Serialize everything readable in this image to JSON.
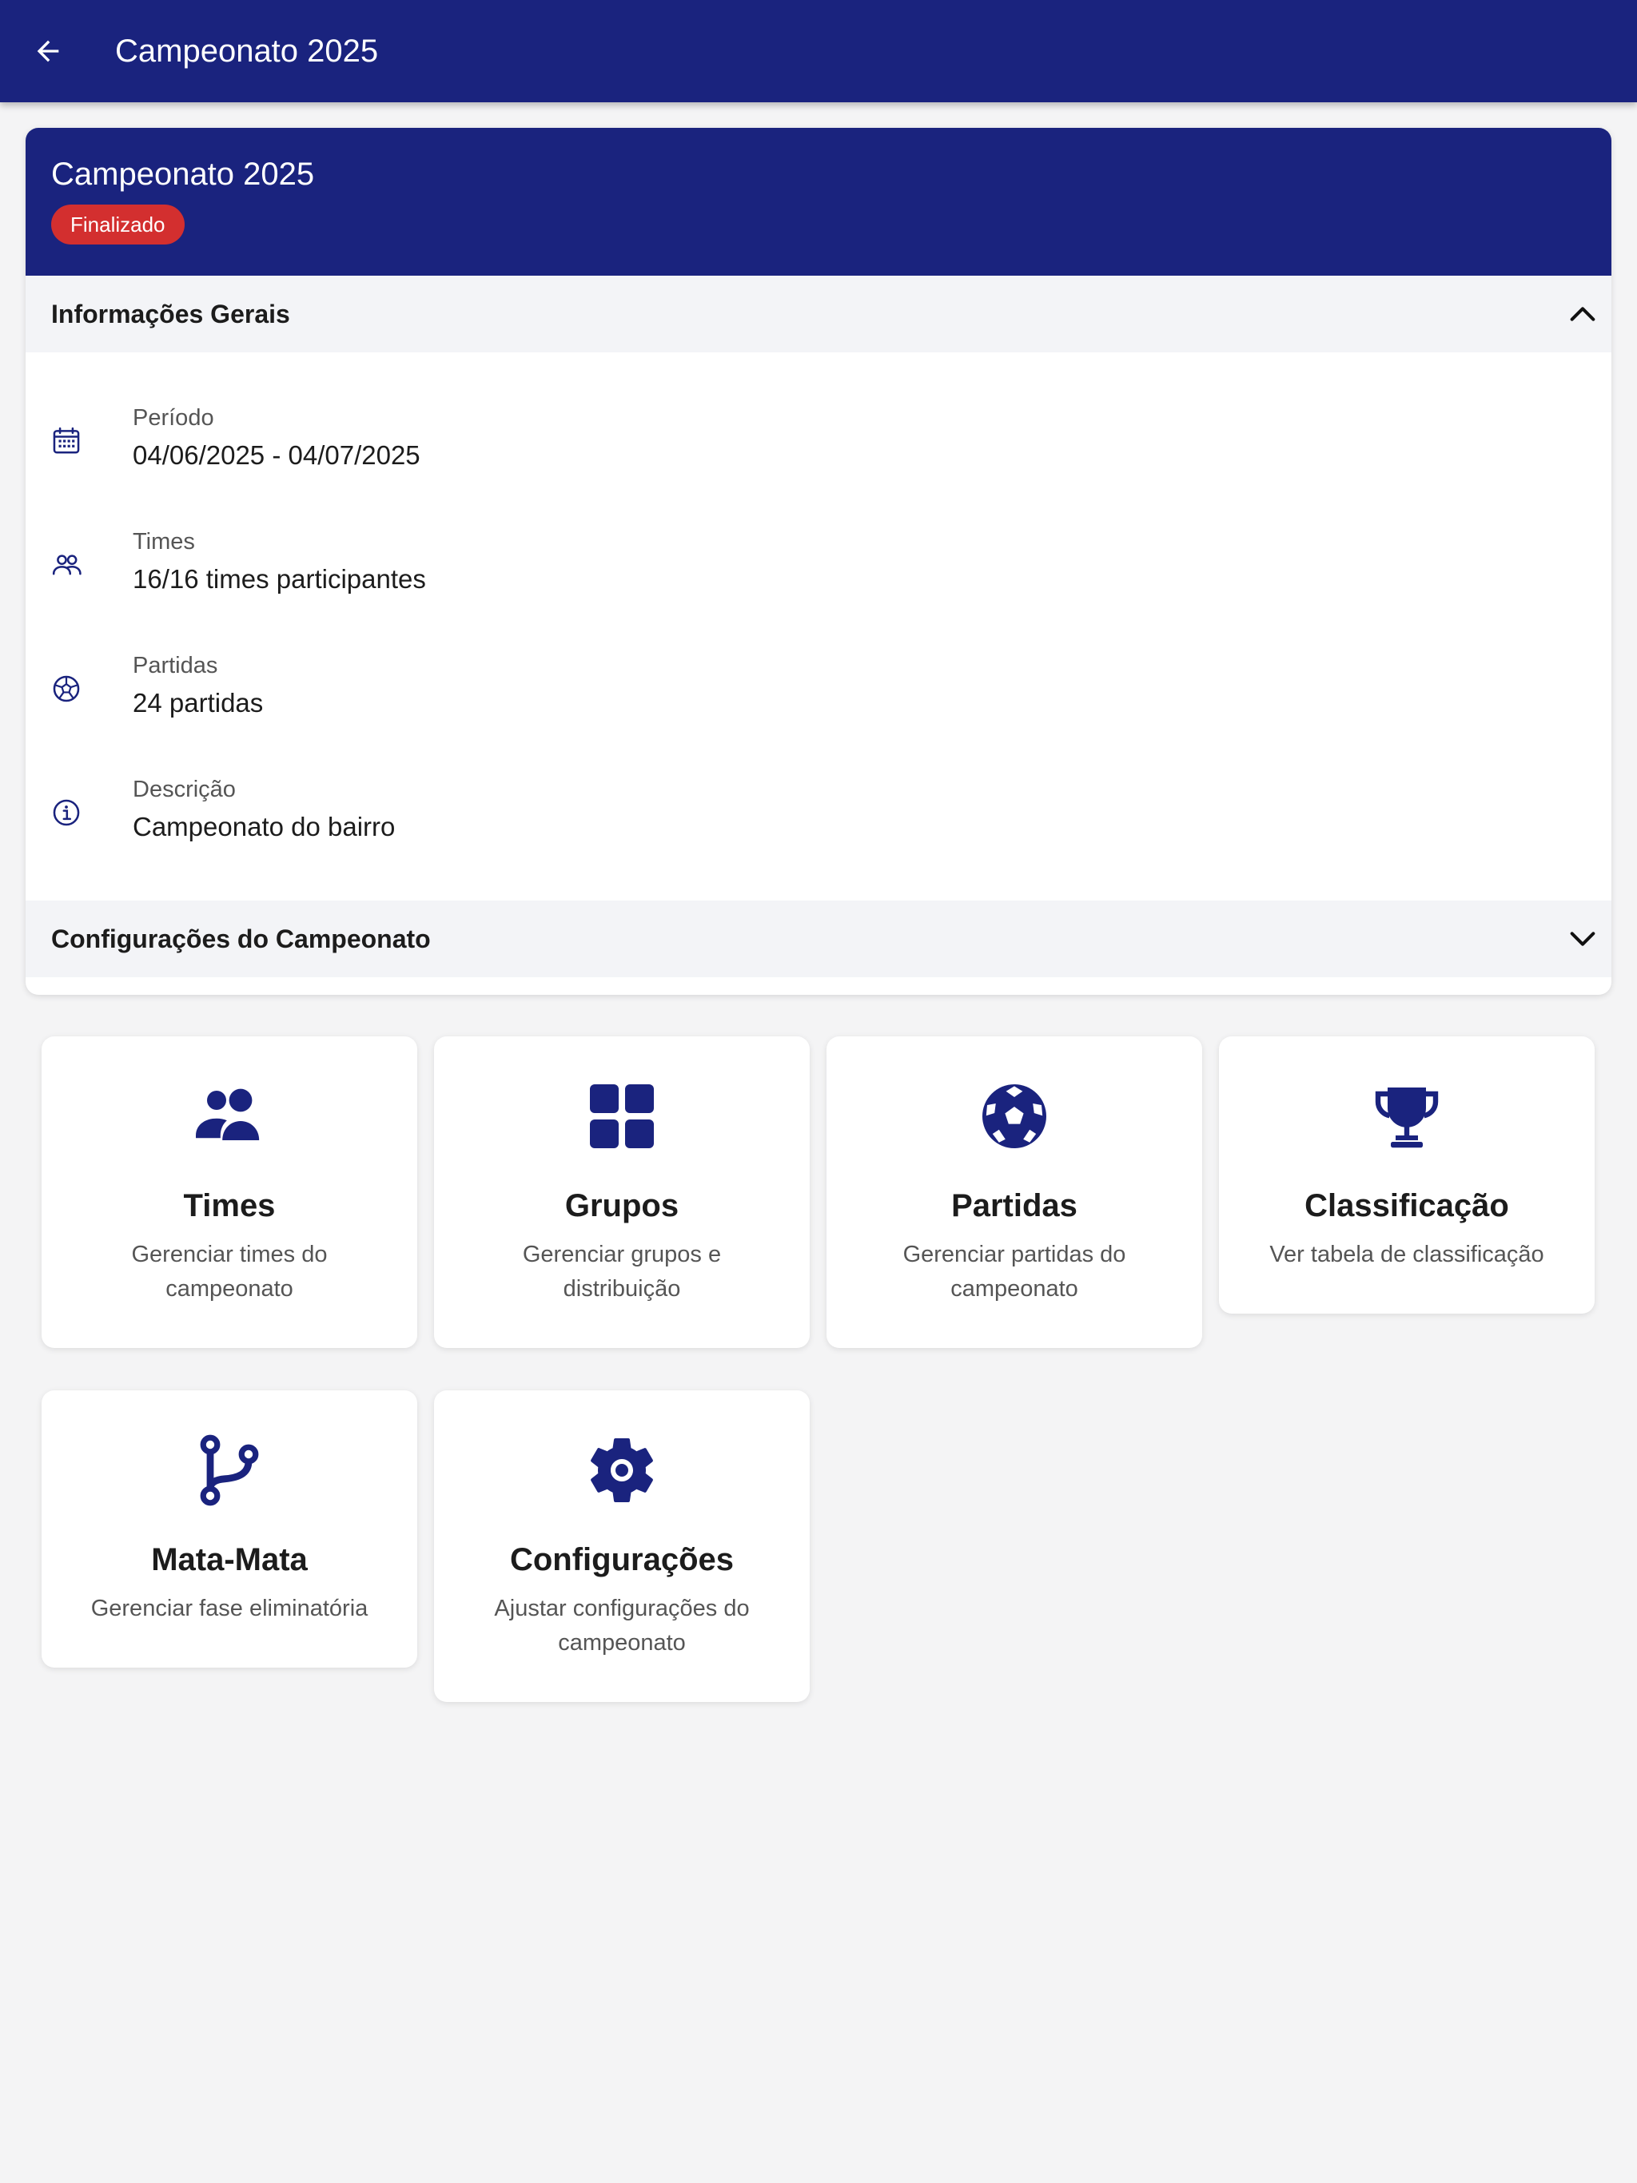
{
  "appbar": {
    "title": "Campeonato 2025",
    "back_icon": "arrow-left-icon"
  },
  "card": {
    "title": "Campeonato 2025",
    "status": "Finalizado",
    "status_color": "#d32f2f"
  },
  "general_info": {
    "title": "Informações Gerais",
    "expanded": true,
    "items": [
      {
        "icon": "calendar-icon",
        "label": "Período",
        "value": "04/06/2025 - 04/07/2025"
      },
      {
        "icon": "users-icon",
        "label": "Times",
        "value": "16/16 times participantes"
      },
      {
        "icon": "soccer-ball-icon",
        "label": "Partidas",
        "value": "24 partidas"
      },
      {
        "icon": "info-icon",
        "label": "Descrição",
        "value": "Campeonato do bairro"
      }
    ]
  },
  "settings_section": {
    "title": "Configurações do Campeonato",
    "expanded": false
  },
  "tiles": [
    {
      "icon": "teams-icon",
      "title": "Times",
      "description": "Gerenciar times do campeonato"
    },
    {
      "icon": "grid-icon",
      "title": "Grupos",
      "description": "Gerenciar grupos e distribuição"
    },
    {
      "icon": "soccer-ball-icon",
      "title": "Partidas",
      "description": "Gerenciar partidas do campeonato"
    },
    {
      "icon": "trophy-icon",
      "title": "Classificação",
      "description": "Ver tabela de classificação"
    },
    {
      "icon": "branch-icon",
      "title": "Mata-Mata",
      "description": "Gerenciar fase eliminatória"
    },
    {
      "icon": "gear-icon",
      "title": "Configurações",
      "description": "Ajustar configurações do campeonato"
    }
  ],
  "colors": {
    "primary": "#1a237e",
    "background": "#f4f4f5",
    "section_bg": "#f3f4f7"
  }
}
